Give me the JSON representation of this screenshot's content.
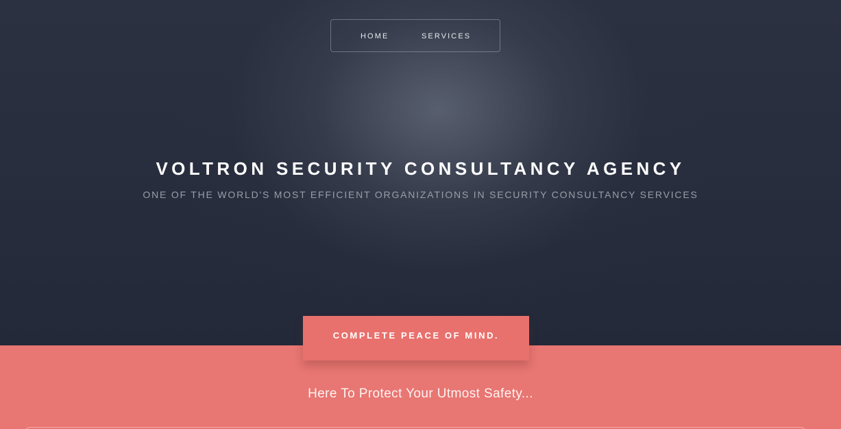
{
  "nav": {
    "items": [
      {
        "label": "HOME"
      },
      {
        "label": "SERVICES"
      }
    ]
  },
  "hero": {
    "title": "VOLTRON SECURITY CONSULTANCY AGENCY",
    "subtitle": "ONE OF THE WORLD'S MOST EFFICIENT ORGANIZATIONS IN SECURITY CONSULTANCY SERVICES"
  },
  "tagline": {
    "label": "COMPLETE PEACE OF MIND."
  },
  "content": {
    "heading": "Here To Protect Your Utmost Safety..."
  },
  "colors": {
    "hero_background": "#272d3d",
    "accent_coral": "#e8716d",
    "title_white": "#ffffff",
    "subtitle_gray": "#9a9ea8"
  }
}
